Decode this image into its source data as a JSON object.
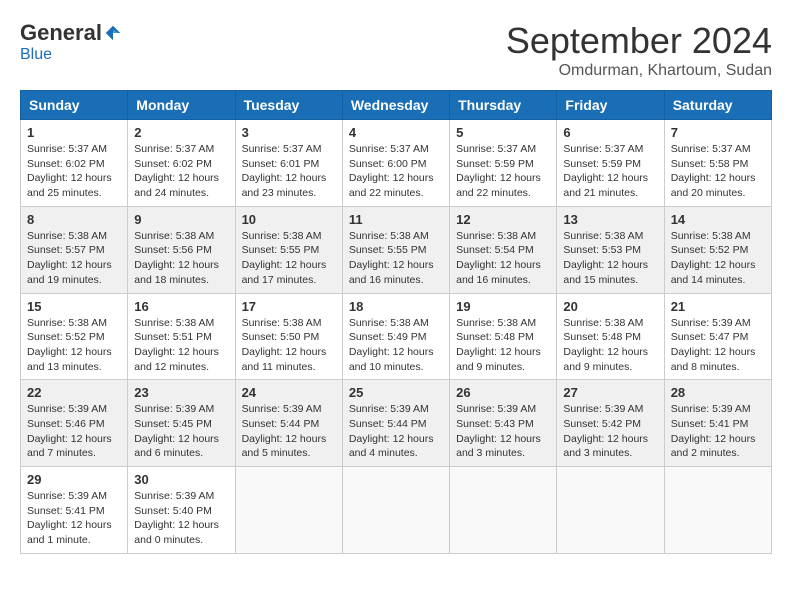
{
  "logo": {
    "general": "General",
    "blue": "Blue"
  },
  "header": {
    "month": "September 2024",
    "location": "Omdurman, Khartoum, Sudan"
  },
  "weekdays": [
    "Sunday",
    "Monday",
    "Tuesday",
    "Wednesday",
    "Thursday",
    "Friday",
    "Saturday"
  ],
  "weeks": [
    [
      {
        "day": "1",
        "sunrise": "5:37 AM",
        "sunset": "6:02 PM",
        "daylight": "12 hours and 25 minutes."
      },
      {
        "day": "2",
        "sunrise": "5:37 AM",
        "sunset": "6:02 PM",
        "daylight": "12 hours and 24 minutes."
      },
      {
        "day": "3",
        "sunrise": "5:37 AM",
        "sunset": "6:01 PM",
        "daylight": "12 hours and 23 minutes."
      },
      {
        "day": "4",
        "sunrise": "5:37 AM",
        "sunset": "6:00 PM",
        "daylight": "12 hours and 22 minutes."
      },
      {
        "day": "5",
        "sunrise": "5:37 AM",
        "sunset": "5:59 PM",
        "daylight": "12 hours and 22 minutes."
      },
      {
        "day": "6",
        "sunrise": "5:37 AM",
        "sunset": "5:59 PM",
        "daylight": "12 hours and 21 minutes."
      },
      {
        "day": "7",
        "sunrise": "5:37 AM",
        "sunset": "5:58 PM",
        "daylight": "12 hours and 20 minutes."
      }
    ],
    [
      {
        "day": "8",
        "sunrise": "5:38 AM",
        "sunset": "5:57 PM",
        "daylight": "12 hours and 19 minutes."
      },
      {
        "day": "9",
        "sunrise": "5:38 AM",
        "sunset": "5:56 PM",
        "daylight": "12 hours and 18 minutes."
      },
      {
        "day": "10",
        "sunrise": "5:38 AM",
        "sunset": "5:55 PM",
        "daylight": "12 hours and 17 minutes."
      },
      {
        "day": "11",
        "sunrise": "5:38 AM",
        "sunset": "5:55 PM",
        "daylight": "12 hours and 16 minutes."
      },
      {
        "day": "12",
        "sunrise": "5:38 AM",
        "sunset": "5:54 PM",
        "daylight": "12 hours and 16 minutes."
      },
      {
        "day": "13",
        "sunrise": "5:38 AM",
        "sunset": "5:53 PM",
        "daylight": "12 hours and 15 minutes."
      },
      {
        "day": "14",
        "sunrise": "5:38 AM",
        "sunset": "5:52 PM",
        "daylight": "12 hours and 14 minutes."
      }
    ],
    [
      {
        "day": "15",
        "sunrise": "5:38 AM",
        "sunset": "5:52 PM",
        "daylight": "12 hours and 13 minutes."
      },
      {
        "day": "16",
        "sunrise": "5:38 AM",
        "sunset": "5:51 PM",
        "daylight": "12 hours and 12 minutes."
      },
      {
        "day": "17",
        "sunrise": "5:38 AM",
        "sunset": "5:50 PM",
        "daylight": "12 hours and 11 minutes."
      },
      {
        "day": "18",
        "sunrise": "5:38 AM",
        "sunset": "5:49 PM",
        "daylight": "12 hours and 10 minutes."
      },
      {
        "day": "19",
        "sunrise": "5:38 AM",
        "sunset": "5:48 PM",
        "daylight": "12 hours and 9 minutes."
      },
      {
        "day": "20",
        "sunrise": "5:38 AM",
        "sunset": "5:48 PM",
        "daylight": "12 hours and 9 minutes."
      },
      {
        "day": "21",
        "sunrise": "5:39 AM",
        "sunset": "5:47 PM",
        "daylight": "12 hours and 8 minutes."
      }
    ],
    [
      {
        "day": "22",
        "sunrise": "5:39 AM",
        "sunset": "5:46 PM",
        "daylight": "12 hours and 7 minutes."
      },
      {
        "day": "23",
        "sunrise": "5:39 AM",
        "sunset": "5:45 PM",
        "daylight": "12 hours and 6 minutes."
      },
      {
        "day": "24",
        "sunrise": "5:39 AM",
        "sunset": "5:44 PM",
        "daylight": "12 hours and 5 minutes."
      },
      {
        "day": "25",
        "sunrise": "5:39 AM",
        "sunset": "5:44 PM",
        "daylight": "12 hours and 4 minutes."
      },
      {
        "day": "26",
        "sunrise": "5:39 AM",
        "sunset": "5:43 PM",
        "daylight": "12 hours and 3 minutes."
      },
      {
        "day": "27",
        "sunrise": "5:39 AM",
        "sunset": "5:42 PM",
        "daylight": "12 hours and 3 minutes."
      },
      {
        "day": "28",
        "sunrise": "5:39 AM",
        "sunset": "5:41 PM",
        "daylight": "12 hours and 2 minutes."
      }
    ],
    [
      {
        "day": "29",
        "sunrise": "5:39 AM",
        "sunset": "5:41 PM",
        "daylight": "12 hours and 1 minute."
      },
      {
        "day": "30",
        "sunrise": "5:39 AM",
        "sunset": "5:40 PM",
        "daylight": "12 hours and 0 minutes."
      },
      null,
      null,
      null,
      null,
      null
    ]
  ],
  "labels": {
    "sunrise": "Sunrise:",
    "sunset": "Sunset:",
    "daylight": "Daylight:"
  }
}
